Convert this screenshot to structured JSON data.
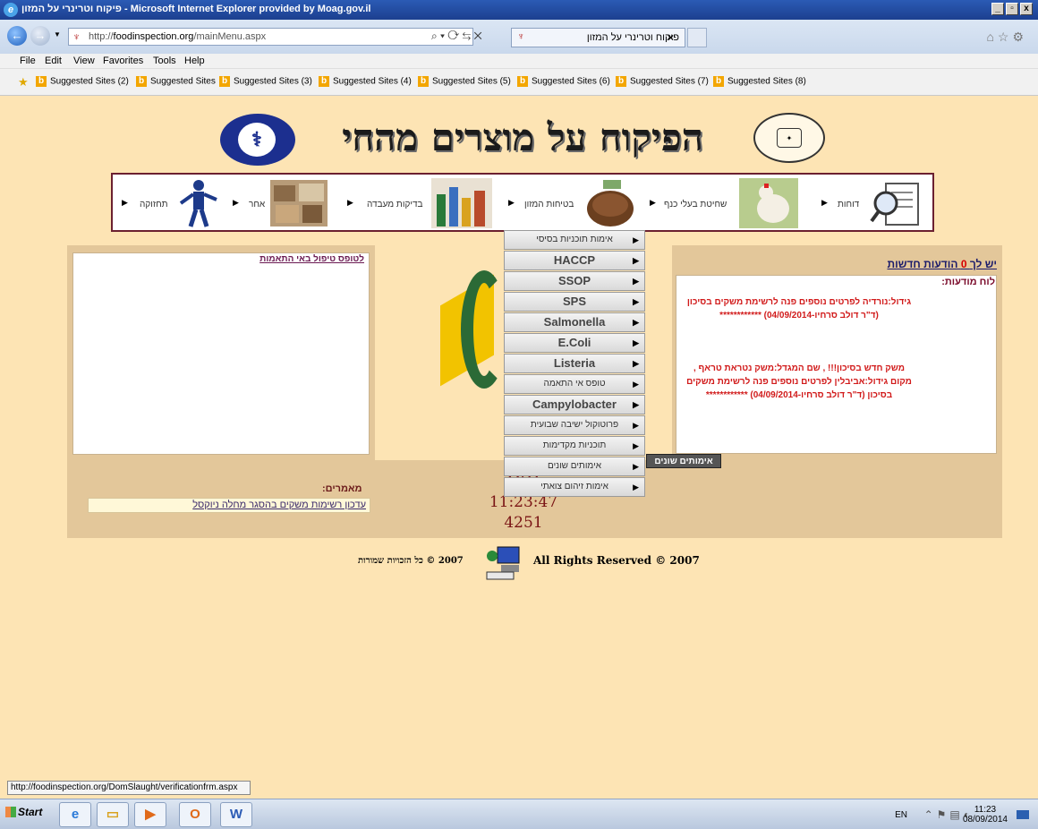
{
  "window": {
    "title": "פיקוח וטרינרי על המזון - Microsoft Internet Explorer provided by Moag.gov.il",
    "minimize": "_",
    "maximize": "▫",
    "close": "x"
  },
  "browser": {
    "address_prefix": "http://",
    "address_domain": "foodinspection.org",
    "address_path": "/mainMenu.aspx",
    "tab_title": "פיקוח וטרינרי על המזון",
    "tab_close": "×"
  },
  "menu": [
    "File",
    "Edit",
    "View",
    "Favorites",
    "Tools",
    "Help"
  ],
  "favorites": [
    "Suggested Sites (2)",
    "Suggested Sites",
    "Suggested Sites (3)",
    "Suggested Sites (4)",
    "Suggested Sites (5)",
    "Suggested Sites (6)",
    "Suggested Sites (7)",
    "Suggested Sites (8)"
  ],
  "header": {
    "title": "הפיקוח על מוצרים מהחי"
  },
  "nav": [
    {
      "label": "דוחות",
      "icon": "magnifier-report-icon"
    },
    {
      "label": "שחיטת בעלי כנף",
      "icon": "chicken-icon"
    },
    {
      "label": "בטיחות המזון",
      "icon": "bread-icon"
    },
    {
      "label": "בדיקות מעבדה",
      "icon": "lab-bottles-icon"
    },
    {
      "label": "אחר",
      "icon": "food-icon"
    },
    {
      "label": "תחזוקה",
      "icon": "worker-icon"
    }
  ],
  "dropdown": [
    {
      "label": "אימות תוכניות בסיסי",
      "bold": false
    },
    {
      "label": "HACCP",
      "bold": true
    },
    {
      "label": "SSOP",
      "bold": true
    },
    {
      "label": "SPS",
      "bold": true
    },
    {
      "label": "Salmonella",
      "bold": true
    },
    {
      "label": "E.Coli",
      "bold": true
    },
    {
      "label": "Listeria",
      "bold": true
    },
    {
      "label": "טופס אי התאמה",
      "bold": false
    },
    {
      "label": "Campylobacter",
      "bold": true
    },
    {
      "label": "פרוטוקול ישיבה שבועית",
      "bold": false
    },
    {
      "label": "תוכניות מקדימות",
      "bold": false
    },
    {
      "label": "אימותים שונים",
      "bold": false
    },
    {
      "label": "אימות זיהום צואתי",
      "bold": false
    }
  ],
  "submenu": {
    "label": "אימותים שונים"
  },
  "left_panel": {
    "link": "לטופס טיפול באי התאמות"
  },
  "right_panel": {
    "messages_prefix": "יש לך",
    "messages_count": "0",
    "messages_suffix": "הודעות חדשות",
    "board_title": "לוח מודעות:",
    "msg1": "גידול:נורדיה לפרטים נוספים פנה לרשימת משקים בסיכון (ד\"ר דולב סרחיו-04/09/2014) ************",
    "msg2": "משק חדש בסיכון!!! , שם המגדל:משק נטראת טראף , מקום גידול:אביבלין לפרטים נוספים פנה לרשימת משקים בסיכון (ד\"ר דולב סרחיו-04/09/2014) ************"
  },
  "articles": {
    "title": "מאמרים:",
    "link": "עדכון רשימות משקים בהסגר מחלה ניוקסל"
  },
  "clock": {
    "date": "8/0",
    "time": "11:23:47",
    "count": "4251"
  },
  "footer": {
    "hebrew": "2007 © כל הזכויות שמורות",
    "english": "All Rights Reserved © 2007"
  },
  "status_url": "http://foodinspection.org/DomSlaught/verificationfrm.aspx",
  "taskbar": {
    "start": "Start",
    "lang": "EN",
    "time": "11:23",
    "date": "08/09/2014",
    "apps": [
      "ie-icon",
      "folder-icon",
      "media-icon",
      "outlook-icon",
      "word-icon"
    ]
  }
}
